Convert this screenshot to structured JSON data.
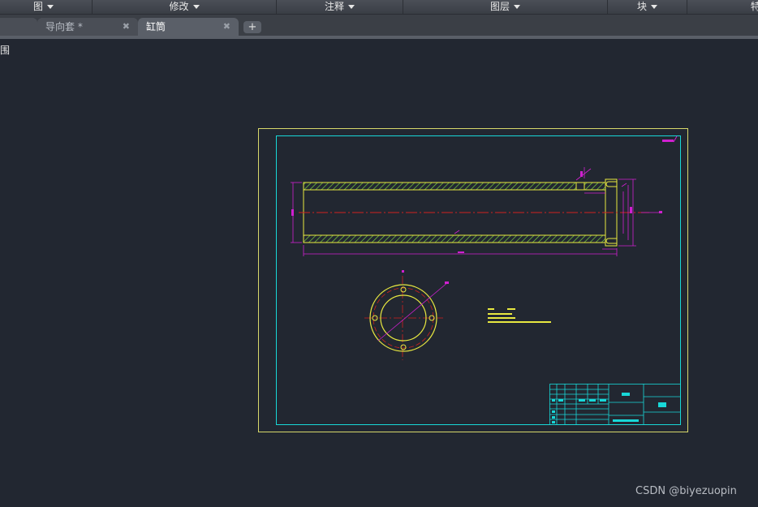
{
  "menubar": {
    "items": [
      {
        "label": "图"
      },
      {
        "label": "修改"
      },
      {
        "label": "注释"
      },
      {
        "label": "图层"
      },
      {
        "label": "块"
      },
      {
        "label": "特"
      }
    ]
  },
  "tabs": [
    {
      "label": ""
    },
    {
      "label": "导向套 *"
    },
    {
      "label": "缸筒"
    }
  ],
  "side_label": "围",
  "watermark": "CSDN @biyezuopin",
  "colors": {
    "canvas": "#222731",
    "frame_outer": "#d8d86a",
    "frame_inner": "#18d8d8",
    "part_outline": "#e8e840",
    "hatch": "#7ad040",
    "dimension": "#d020d0",
    "centerline": "#d02020"
  }
}
